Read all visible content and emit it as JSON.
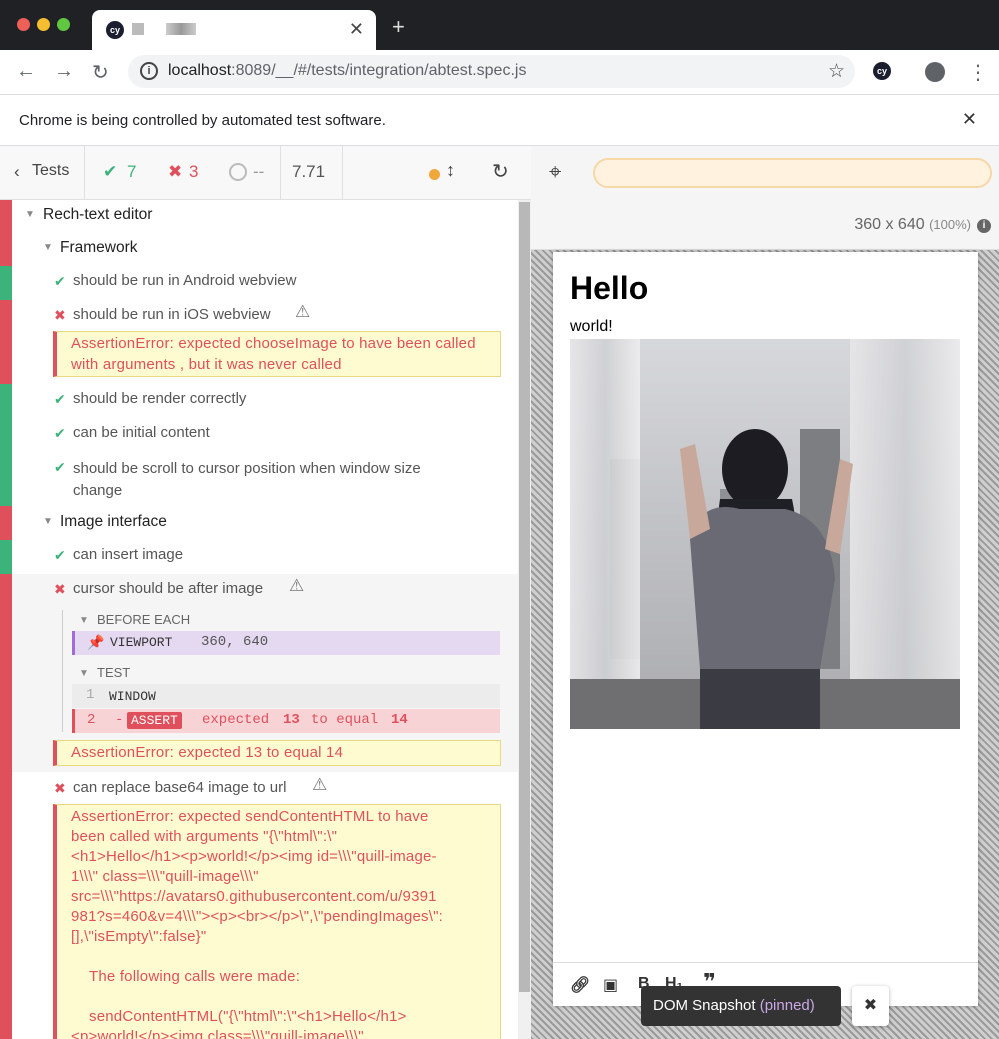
{
  "browser": {
    "tab_title_blurred": "",
    "url_host": "localhost",
    "url_rest": ":8089/__/#/tests/integration/abtest.spec.js",
    "infobar_message": "Chrome is being controlled by automated test software.",
    "colors": {
      "tabstrip": "#202124",
      "red_light": "#ee5f57",
      "yellow_light": "#f5bd30",
      "green_light": "#5fc840"
    }
  },
  "reporter": {
    "header": {
      "back_label": "Tests",
      "passed": "7",
      "failed": "3",
      "pending": "--",
      "duration": "7.71"
    },
    "suites": {
      "root": "Rech-text editor",
      "framework": "Framework",
      "image": "Image interface"
    },
    "tests": {
      "t1": "should be run in Android webview",
      "t2": "should be run in iOS webview",
      "t2_error": "AssertionError: expected chooseImage to have been called with arguments , but it was never called",
      "t3": "should be render correctly",
      "t4": "can be initial content",
      "t5": "should be scroll to cursor position when window size change",
      "t6": "can insert image",
      "t7": "cursor should be after image",
      "t7_before_each": "BEFORE EACH",
      "t7_cmd_viewport": "VIEWPORT",
      "t7_cmd_viewport_args": "360, 640",
      "t7_test": "TEST",
      "t7_cmd1_num": "1",
      "t7_cmd1": "WINDOW",
      "t7_cmd2_num": "2",
      "t7_cmd2_prefix": "-",
      "t7_cmd2": "ASSERT",
      "t7_cmd2_msg_a": "expected",
      "t7_cmd2_msg_b": "13",
      "t7_cmd2_msg_c": "to equal",
      "t7_cmd2_msg_d": "14",
      "t7_error": "AssertionError: expected 13 to equal 14",
      "t8": "can replace base64 image to url",
      "t8_error_1": "AssertionError: expected sendContentHTML to have",
      "t8_error_2": "been called with arguments \"{\\\"html\\\":\\\"",
      "t8_error_3": "<h1>Hello</h1><p>world!</p><img id=\\\\\\\"quill-image-",
      "t8_error_4": "1\\\\\\\" class=\\\\\\\"quill-image\\\\\\\"",
      "t8_error_5": "src=\\\\\\\"https://avatars0.githubusercontent.com/u/9391",
      "t8_error_6": "981?s=460&v=4\\\\\\\"><p><br></p>\\\",\\\"pendingImages\\\":",
      "t8_error_7": "[],\\\"isEmpty\\\":false}\"",
      "t8_error_8": "The following calls were made:",
      "t8_error_9": "sendContentHTML(\"{\\\"html\\\":\\\"<h1>Hello</h1>",
      "t8_error_10": "<p>world!</p><img class=\\\\\\\"quill-image\\\\\\\""
    },
    "colors": {
      "pass": "#3cb37b",
      "fail": "#e0505c",
      "pending": "#f0a73b"
    }
  },
  "aut": {
    "viewport_size": "360 x 640",
    "viewport_scale": "(100%)",
    "page": {
      "heading": "Hello",
      "paragraph": "world!"
    },
    "snapshot_label": "DOM Snapshot",
    "snapshot_pinned": "(pinned)"
  }
}
